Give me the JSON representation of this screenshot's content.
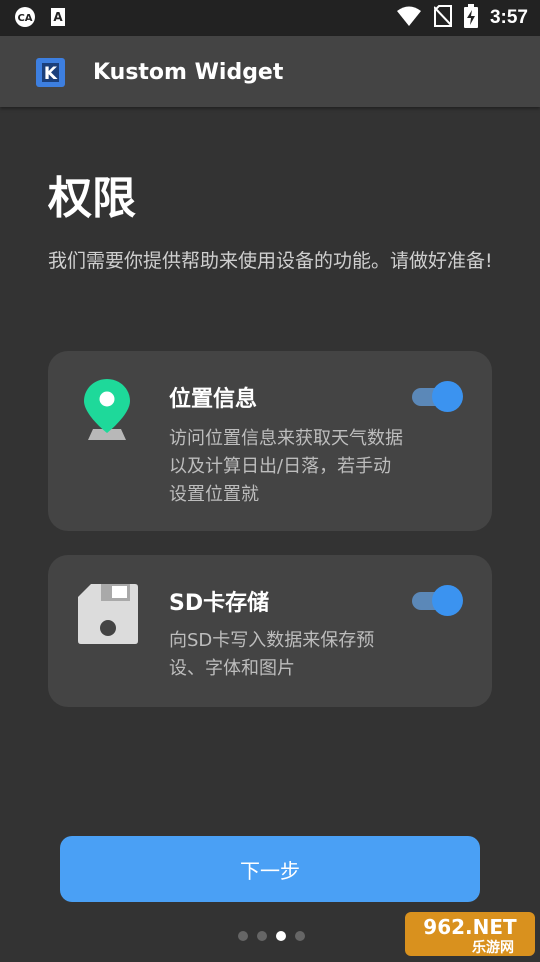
{
  "status_bar": {
    "time": "3:57",
    "icons": [
      "infinity-icon",
      "font-a-icon",
      "wifi-icon",
      "no-sim-icon",
      "battery-charging-icon"
    ]
  },
  "app_bar": {
    "title": "Kustom Widget",
    "logo_letter": "K"
  },
  "page": {
    "title": "权限",
    "subtitle": "我们需要你提供帮助来使用设备的功能。请做好准备!"
  },
  "permissions": [
    {
      "title": "位置信息",
      "description": "访问位置信息来获取天气数据以及计算日出/日落，若手动设置位置就",
      "enabled": true,
      "icon": "location-pin-icon"
    },
    {
      "title": "SD卡存储",
      "description": "向SD卡写入数据来保存预设、字体和图片",
      "enabled": true,
      "icon": "sd-card-icon"
    }
  ],
  "next_button": {
    "label": "下一步"
  },
  "pager": {
    "total": 4,
    "current": 3
  },
  "watermark": {
    "text_top": "962.NET",
    "text_bottom": "乐游网"
  },
  "colors": {
    "background": "#333333",
    "card": "#444444",
    "accent": "#4aa0f5",
    "pin_green": "#1ed99a"
  }
}
